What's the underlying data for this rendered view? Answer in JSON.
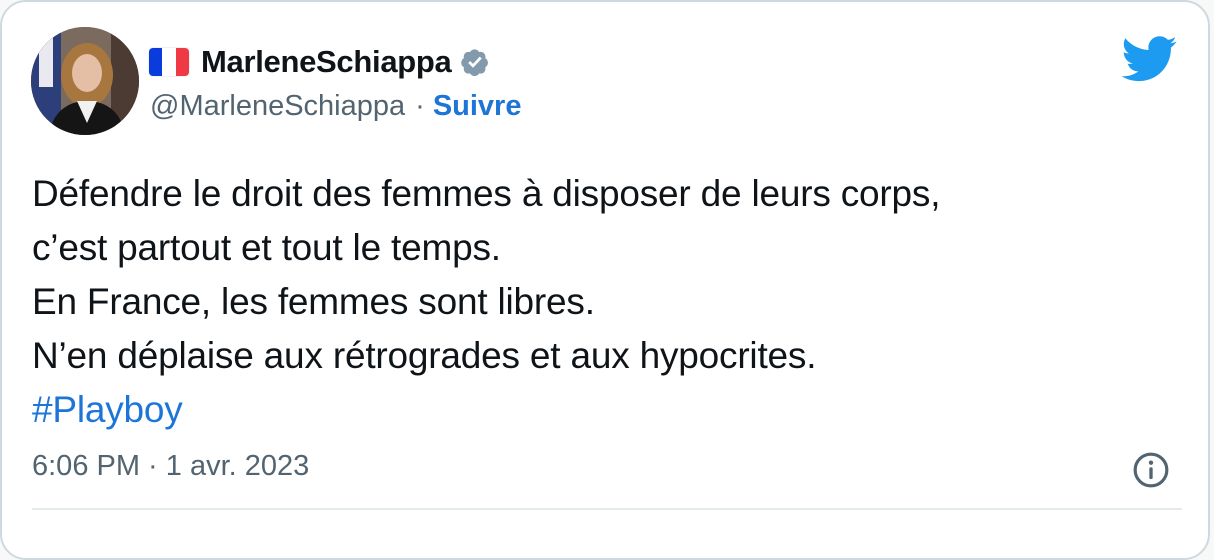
{
  "colors": {
    "accent": "#1d75d8",
    "text": "#0f1419",
    "muted": "#536471",
    "twitter_blue": "#1d9bf0",
    "verified_gray": "#829aab"
  },
  "author": {
    "flag_icon": "france-flag-icon",
    "display_name": "MarleneSchiappa",
    "verified_icon": "verified-badge-icon",
    "handle": "@MarleneSchiappa",
    "separator": "·",
    "follow_label": "Suivre"
  },
  "tweet": {
    "lines": [
      "Défendre le droit des femmes à disposer de leurs corps,",
      "c’est partout et tout le temps.",
      "En France, les femmes sont libres.",
      "N’en déplaise aux rétrogrades et aux hypocrites."
    ],
    "hashtag": "#Playboy"
  },
  "footer": {
    "timestamp": "6:06 PM · 1 avr. 2023",
    "info_icon": "info-icon"
  },
  "brand_icon": "twitter-bird-icon"
}
